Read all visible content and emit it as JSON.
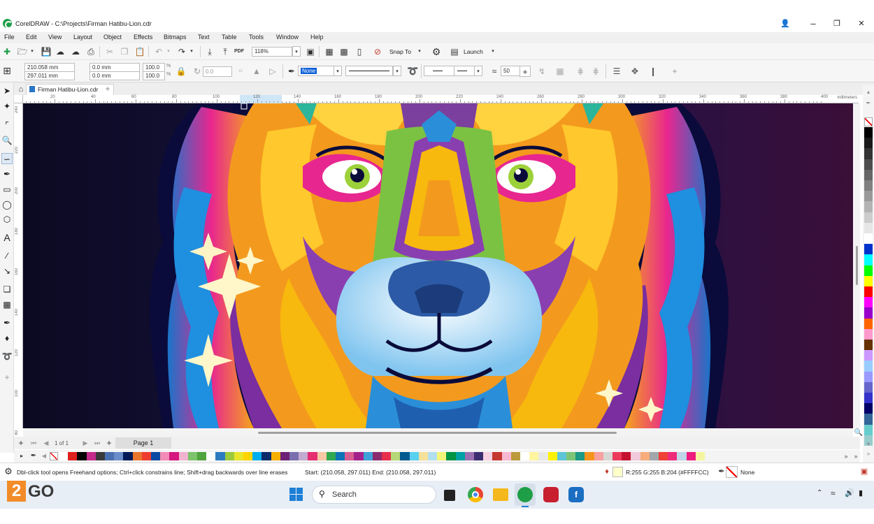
{
  "window": {
    "title": "CorelDRAW - C:\\Projects\\Firman Hatibu-Lion.cdr",
    "minimize": "–",
    "restore": "❐",
    "close": "✕"
  },
  "menu": [
    "File",
    "Edit",
    "View",
    "Layout",
    "Object",
    "Effects",
    "Bitmaps",
    "Text",
    "Table",
    "Tools",
    "Window",
    "Help"
  ],
  "standard_toolbar": {
    "zoom": "118%",
    "snap_to": "Snap To",
    "launch": "Launch",
    "pdf": "PDF"
  },
  "property_bar": {
    "x": "210.058 mm",
    "y": "297.011 mm",
    "width": "0.0 mm",
    "height": "0.0 mm",
    "scale_x": "100.0",
    "scale_y": "100.0",
    "pct": "%",
    "rotation": "0.0",
    "outline_fill": "None",
    "smoothing": "50"
  },
  "document_tab": {
    "label": "Firman Hatibu-Lion.cdr",
    "add": "+"
  },
  "ruler": {
    "unit": "millimeters",
    "ticks": [
      "20",
      "40",
      "60",
      "80",
      "100",
      "120",
      "140",
      "160",
      "180",
      "200",
      "220",
      "240",
      "260",
      "280",
      "300",
      "320",
      "340",
      "360",
      "380",
      "400"
    ],
    "vticks": [
      "240",
      "220",
      "200",
      "180",
      "160",
      "140",
      "120",
      "100",
      "80"
    ]
  },
  "page_nav": {
    "counter": "1 of 1",
    "page_tab": "Page 1"
  },
  "status": {
    "hint": "Dbl-click tool opens Freehand options; Ctrl+click constrains line; Shift+drag backwards over line erases",
    "start_end": "Start: (210.058, 297.011)  End: (210.058, 297.011)",
    "fill_color": "R:255 G:255 B:204 (#FFFFCC)",
    "fill_swatch": "#FFFFCC",
    "outline": "None"
  },
  "taskbar": {
    "search": "Search",
    "watermark": "GO",
    "watermark_digit": "2"
  },
  "colors": {
    "accent": "#1f9e48",
    "ruler_highlight": "#cfe6f7"
  },
  "palette_bottom": [
    "#ffffff",
    "#e0201c",
    "#000000",
    "#c42a8a",
    "#3a3a3a",
    "#4a6fb0",
    "#6b8cc9",
    "#001a57",
    "#e9762b",
    "#ef3e2e",
    "#0b4aa2",
    "#f28cb6",
    "#d6157e",
    "#f1b3cf",
    "#7cc36a",
    "#51a33e",
    "#ffffff",
    "#2c7bc0",
    "#9ccb3b",
    "#e8e52b",
    "#ffd400",
    "#00aeef",
    "#0b2c6b",
    "#f7b000",
    "#6d2077",
    "#7a6fae",
    "#c2aad1",
    "#e62d6f",
    "#f5c9a3",
    "#2fa84f",
    "#0f73b8",
    "#d85d91",
    "#a4218c",
    "#3fa1d9",
    "#8c2a6e",
    "#e72e4b",
    "#b6d775",
    "#00598f",
    "#5ad0f0",
    "#f6e09a",
    "#b2dfee",
    "#f5f57a",
    "#009444",
    "#00a2a5",
    "#9b70b0",
    "#3c2d70",
    "#f8d2e2",
    "#c53830",
    "#f9b8d2",
    "#bb9b3b",
    "#ffffff",
    "#fff5a0",
    "#e8e9e7",
    "#fff200",
    "#5ec5d6",
    "#7cc576",
    "#1c9a85",
    "#f7941d",
    "#f6a0a0",
    "#d7d8d4",
    "#ee3a5a",
    "#c41230",
    "#f1c9d8",
    "#f7ad7c",
    "#a2a7ab",
    "#ef4136",
    "#ee2a7b",
    "#c0d6e8",
    "#ed1c7e",
    "#f5f5a0"
  ],
  "palette_right": [
    "#000000",
    "#1a1a1a",
    "#333333",
    "#4d4d4d",
    "#666666",
    "#808080",
    "#999999",
    "#b3b3b3",
    "#cccccc",
    "#e6e6e6",
    "#ffffff",
    "#0033cc",
    "#00ffff",
    "#00ff00",
    "#ffff00",
    "#ff0000",
    "#ff00ff",
    "#9900cc",
    "#ff6600",
    "#ff99cc",
    "#663300",
    "#cc99ff",
    "#99ccff",
    "#9999ff",
    "#6666cc",
    "#3333cc",
    "#000066",
    "#336699",
    "#66cccc",
    "#99cccc"
  ]
}
